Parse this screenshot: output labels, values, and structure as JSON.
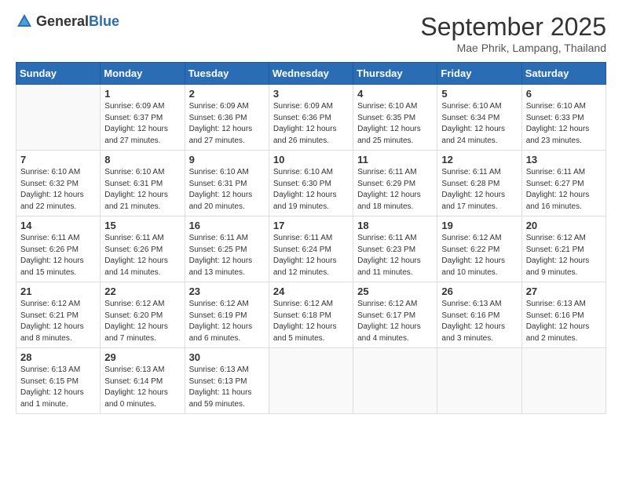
{
  "header": {
    "logo_general": "General",
    "logo_blue": "Blue",
    "month_title": "September 2025",
    "location": "Mae Phrik, Lampang, Thailand"
  },
  "weekdays": [
    "Sunday",
    "Monday",
    "Tuesday",
    "Wednesday",
    "Thursday",
    "Friday",
    "Saturday"
  ],
  "weeks": [
    [
      {
        "day": "",
        "sunrise": "",
        "sunset": "",
        "daylight": "",
        "empty": true
      },
      {
        "day": "1",
        "sunrise": "Sunrise: 6:09 AM",
        "sunset": "Sunset: 6:37 PM",
        "daylight": "Daylight: 12 hours and 27 minutes."
      },
      {
        "day": "2",
        "sunrise": "Sunrise: 6:09 AM",
        "sunset": "Sunset: 6:36 PM",
        "daylight": "Daylight: 12 hours and 27 minutes."
      },
      {
        "day": "3",
        "sunrise": "Sunrise: 6:09 AM",
        "sunset": "Sunset: 6:36 PM",
        "daylight": "Daylight: 12 hours and 26 minutes."
      },
      {
        "day": "4",
        "sunrise": "Sunrise: 6:10 AM",
        "sunset": "Sunset: 6:35 PM",
        "daylight": "Daylight: 12 hours and 25 minutes."
      },
      {
        "day": "5",
        "sunrise": "Sunrise: 6:10 AM",
        "sunset": "Sunset: 6:34 PM",
        "daylight": "Daylight: 12 hours and 24 minutes."
      },
      {
        "day": "6",
        "sunrise": "Sunrise: 6:10 AM",
        "sunset": "Sunset: 6:33 PM",
        "daylight": "Daylight: 12 hours and 23 minutes."
      }
    ],
    [
      {
        "day": "7",
        "sunrise": "Sunrise: 6:10 AM",
        "sunset": "Sunset: 6:32 PM",
        "daylight": "Daylight: 12 hours and 22 minutes."
      },
      {
        "day": "8",
        "sunrise": "Sunrise: 6:10 AM",
        "sunset": "Sunset: 6:31 PM",
        "daylight": "Daylight: 12 hours and 21 minutes."
      },
      {
        "day": "9",
        "sunrise": "Sunrise: 6:10 AM",
        "sunset": "Sunset: 6:31 PM",
        "daylight": "Daylight: 12 hours and 20 minutes."
      },
      {
        "day": "10",
        "sunrise": "Sunrise: 6:10 AM",
        "sunset": "Sunset: 6:30 PM",
        "daylight": "Daylight: 12 hours and 19 minutes."
      },
      {
        "day": "11",
        "sunrise": "Sunrise: 6:11 AM",
        "sunset": "Sunset: 6:29 PM",
        "daylight": "Daylight: 12 hours and 18 minutes."
      },
      {
        "day": "12",
        "sunrise": "Sunrise: 6:11 AM",
        "sunset": "Sunset: 6:28 PM",
        "daylight": "Daylight: 12 hours and 17 minutes."
      },
      {
        "day": "13",
        "sunrise": "Sunrise: 6:11 AM",
        "sunset": "Sunset: 6:27 PM",
        "daylight": "Daylight: 12 hours and 16 minutes."
      }
    ],
    [
      {
        "day": "14",
        "sunrise": "Sunrise: 6:11 AM",
        "sunset": "Sunset: 6:26 PM",
        "daylight": "Daylight: 12 hours and 15 minutes."
      },
      {
        "day": "15",
        "sunrise": "Sunrise: 6:11 AM",
        "sunset": "Sunset: 6:26 PM",
        "daylight": "Daylight: 12 hours and 14 minutes."
      },
      {
        "day": "16",
        "sunrise": "Sunrise: 6:11 AM",
        "sunset": "Sunset: 6:25 PM",
        "daylight": "Daylight: 12 hours and 13 minutes."
      },
      {
        "day": "17",
        "sunrise": "Sunrise: 6:11 AM",
        "sunset": "Sunset: 6:24 PM",
        "daylight": "Daylight: 12 hours and 12 minutes."
      },
      {
        "day": "18",
        "sunrise": "Sunrise: 6:11 AM",
        "sunset": "Sunset: 6:23 PM",
        "daylight": "Daylight: 12 hours and 11 minutes."
      },
      {
        "day": "19",
        "sunrise": "Sunrise: 6:12 AM",
        "sunset": "Sunset: 6:22 PM",
        "daylight": "Daylight: 12 hours and 10 minutes."
      },
      {
        "day": "20",
        "sunrise": "Sunrise: 6:12 AM",
        "sunset": "Sunset: 6:21 PM",
        "daylight": "Daylight: 12 hours and 9 minutes."
      }
    ],
    [
      {
        "day": "21",
        "sunrise": "Sunrise: 6:12 AM",
        "sunset": "Sunset: 6:21 PM",
        "daylight": "Daylight: 12 hours and 8 minutes."
      },
      {
        "day": "22",
        "sunrise": "Sunrise: 6:12 AM",
        "sunset": "Sunset: 6:20 PM",
        "daylight": "Daylight: 12 hours and 7 minutes."
      },
      {
        "day": "23",
        "sunrise": "Sunrise: 6:12 AM",
        "sunset": "Sunset: 6:19 PM",
        "daylight": "Daylight: 12 hours and 6 minutes."
      },
      {
        "day": "24",
        "sunrise": "Sunrise: 6:12 AM",
        "sunset": "Sunset: 6:18 PM",
        "daylight": "Daylight: 12 hours and 5 minutes."
      },
      {
        "day": "25",
        "sunrise": "Sunrise: 6:12 AM",
        "sunset": "Sunset: 6:17 PM",
        "daylight": "Daylight: 12 hours and 4 minutes."
      },
      {
        "day": "26",
        "sunrise": "Sunrise: 6:13 AM",
        "sunset": "Sunset: 6:16 PM",
        "daylight": "Daylight: 12 hours and 3 minutes."
      },
      {
        "day": "27",
        "sunrise": "Sunrise: 6:13 AM",
        "sunset": "Sunset: 6:16 PM",
        "daylight": "Daylight: 12 hours and 2 minutes."
      }
    ],
    [
      {
        "day": "28",
        "sunrise": "Sunrise: 6:13 AM",
        "sunset": "Sunset: 6:15 PM",
        "daylight": "Daylight: 12 hours and 1 minute."
      },
      {
        "day": "29",
        "sunrise": "Sunrise: 6:13 AM",
        "sunset": "Sunset: 6:14 PM",
        "daylight": "Daylight: 12 hours and 0 minutes."
      },
      {
        "day": "30",
        "sunrise": "Sunrise: 6:13 AM",
        "sunset": "Sunset: 6:13 PM",
        "daylight": "Daylight: 11 hours and 59 minutes."
      },
      {
        "day": "",
        "sunrise": "",
        "sunset": "",
        "daylight": "",
        "empty": true
      },
      {
        "day": "",
        "sunrise": "",
        "sunset": "",
        "daylight": "",
        "empty": true
      },
      {
        "day": "",
        "sunrise": "",
        "sunset": "",
        "daylight": "",
        "empty": true
      },
      {
        "day": "",
        "sunrise": "",
        "sunset": "",
        "daylight": "",
        "empty": true
      }
    ]
  ]
}
